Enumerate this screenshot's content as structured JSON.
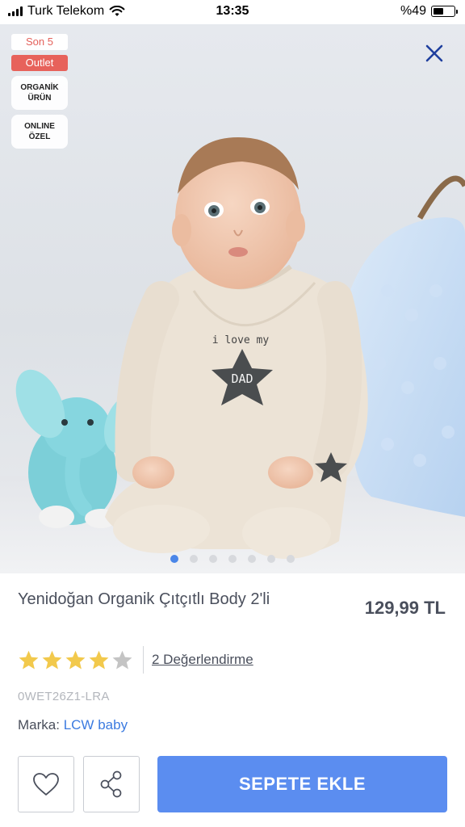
{
  "status_bar": {
    "carrier": "Turk Telekom",
    "time": "13:35",
    "battery_text": "%49",
    "battery_level": 0.49
  },
  "badges": {
    "stock": "Son 5",
    "outlet": "Outlet",
    "organic": "ORGANİK\nÜRÜN",
    "online": "ONLINE\nÖZEL"
  },
  "photo": {
    "shirt_text": "i love my",
    "star_text": "DAD"
  },
  "carousel": {
    "count": 7,
    "active_index": 0
  },
  "product": {
    "title": "Yenidoğan Organik Çıtçıtlı Body 2'li",
    "price": "129,99 TL",
    "rating": 4,
    "rating_max": 5,
    "review_link": "2 Değerlendirme",
    "sku": "0WET26Z1-LRA",
    "brand_label": "Marka:",
    "brand_name": "LCW baby"
  },
  "actions": {
    "add_to_cart": "SEPETE EKLE"
  },
  "colors": {
    "accent": "#5b8df0",
    "outlet_badge": "#e7625b",
    "star_filled": "#f2c94c",
    "star_empty": "#c4c4c4",
    "brand_link": "#3c7be0"
  },
  "icons": {
    "close": "close-icon",
    "favorite": "heart-icon",
    "share": "share-icon",
    "wifi": "wifi-icon"
  }
}
